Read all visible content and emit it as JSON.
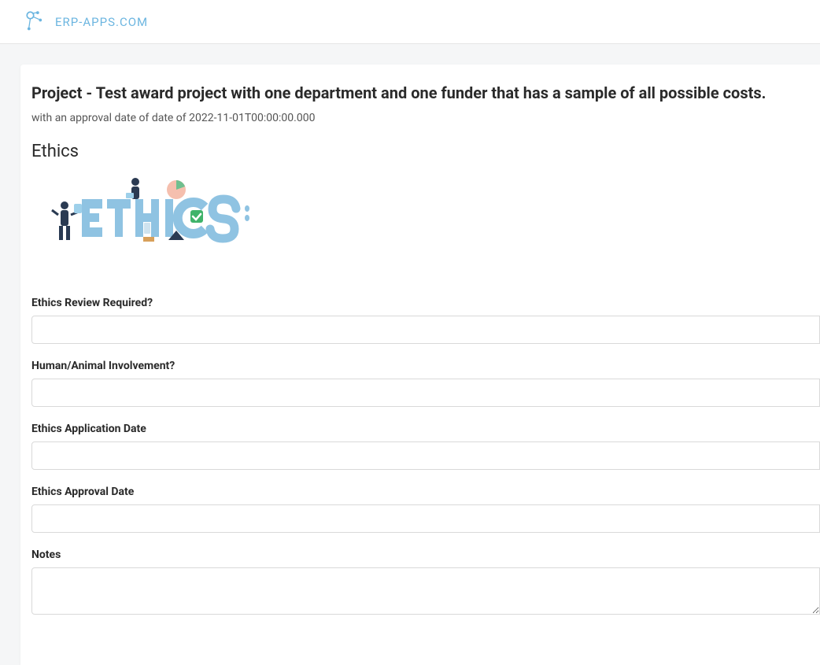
{
  "brand": {
    "name": "ERP-APPS.COM"
  },
  "page": {
    "title": "Project - Test award project with one department and one funder that has a sample of all possible costs.",
    "subtitle": "with an approval date of date of 2022-11-01T00:00:00.000",
    "section": "Ethics",
    "hero_word": "ETHICS"
  },
  "form": {
    "ethics_review_required": {
      "label": "Ethics Review Required?",
      "value": ""
    },
    "human_animal_involvement": {
      "label": "Human/Animal Involvement?",
      "value": ""
    },
    "ethics_application_date": {
      "label": "Ethics Application Date",
      "value": ""
    },
    "ethics_approval_date": {
      "label": "Ethics Approval Date",
      "value": ""
    },
    "notes": {
      "label": "Notes",
      "value": ""
    }
  }
}
